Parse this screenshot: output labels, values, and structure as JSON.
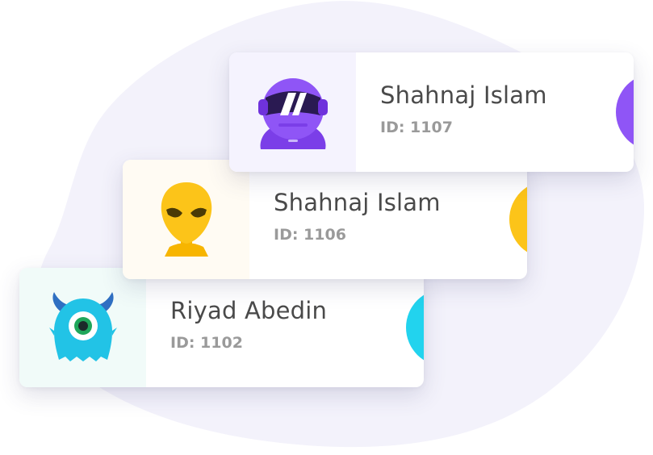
{
  "colors": {
    "blob": "#f3f2fb",
    "name_text": "#4a4a4a",
    "id_text": "#9a9a9a"
  },
  "cards": [
    {
      "name": "Shahnaj Islam",
      "id_label": "ID: 1107",
      "avatar_icon": "astronaut-helmet-icon",
      "accent": "#8f55f6",
      "panel_bg": "#f5f3fe"
    },
    {
      "name": "Shahnaj Islam",
      "id_label": "ID: 1106",
      "avatar_icon": "alien-head-icon",
      "accent": "#fcc419",
      "panel_bg": "#fffbf3"
    },
    {
      "name": "Riyad Abedin",
      "id_label": "ID: 1102",
      "avatar_icon": "one-eyed-monster-icon",
      "accent": "#22d3ee",
      "panel_bg": "#f1fbf9"
    }
  ]
}
